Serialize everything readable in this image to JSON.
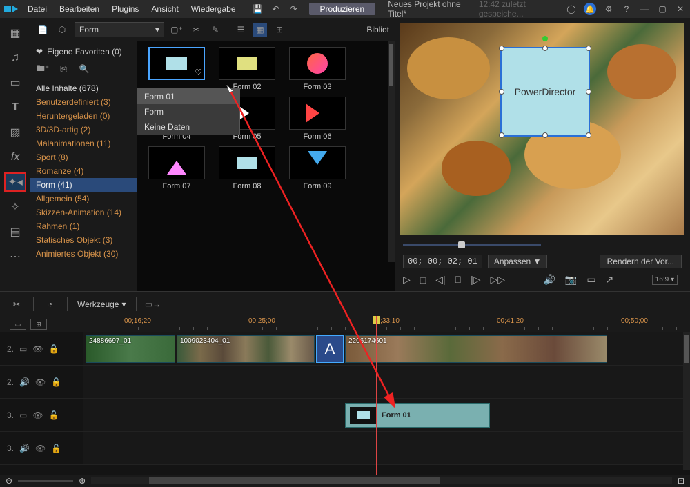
{
  "titlebar": {
    "menus": [
      "Datei",
      "Bearbeiten",
      "Plugins",
      "Ansicht",
      "Wiedergabe"
    ],
    "produce": "Produzieren",
    "project": "Neues Projekt ohne Titel*",
    "time_saved": "12:42 zuletzt gespeiche..."
  },
  "media": {
    "dropdown_label": "Form",
    "right_label": "Bibliot",
    "favorites_header": "Eigene Favoriten (0)",
    "categories": [
      {
        "label": "Alle Inhalte (678)",
        "white": true
      },
      {
        "label": "Benutzerdefiniert  (3)"
      },
      {
        "label": "Heruntergeladen  (0)"
      },
      {
        "label": "3D/3D-artig  (2)"
      },
      {
        "label": "Malanimationen  (11)"
      },
      {
        "label": "Sport  (8)"
      },
      {
        "label": "Romanze  (4)"
      },
      {
        "label": "Form  (41)",
        "selected": true
      },
      {
        "label": "Allgemein  (54)"
      },
      {
        "label": "Skizzen-Animation  (14)"
      },
      {
        "label": "Rahmen  (1)"
      },
      {
        "label": "Statisches Objekt  (3)"
      },
      {
        "label": "Animiertes Objekt  (30)"
      }
    ],
    "thumbs": [
      "",
      "Form 02",
      "Form 03",
      "Form 04",
      "Form 05",
      "Form 06",
      "Form 07",
      "Form 08",
      "Form 09"
    ],
    "context_menu": [
      "Form 01",
      "Form",
      "Keine Daten"
    ]
  },
  "preview": {
    "overlay_text": "PowerDirector",
    "timecode": "00; 00; 02; 01",
    "fit_label": "Anpassen ▼",
    "render_label": "Rendern der Vor...",
    "aspect": "16:9 ▾"
  },
  "timeline": {
    "tools_label": "Werkzeuge",
    "ruler_ticks": [
      "00;16;20",
      "00;25;00",
      "00;33;10",
      "00;41;20",
      "00;50;00"
    ],
    "track_labels": [
      "2.",
      "2.",
      "3.",
      "3."
    ],
    "clip_names": [
      "24886697_01",
      "1009023404_01",
      "2206174601"
    ],
    "fx_clip_label": "Form 01"
  }
}
